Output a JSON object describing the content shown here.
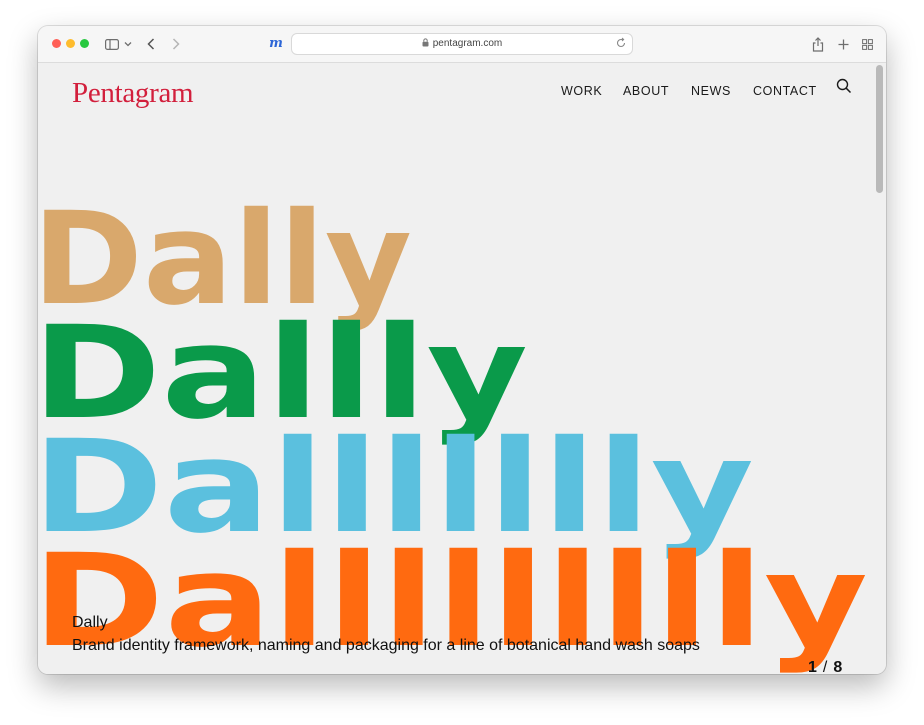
{
  "browser": {
    "url": "pentagram.com"
  },
  "site": {
    "logo": "Pentagram",
    "nav": [
      {
        "label": "WORK"
      },
      {
        "label": "ABOUT"
      },
      {
        "label": "NEWS"
      },
      {
        "label": "CONTACT"
      }
    ]
  },
  "hero": {
    "words": [
      {
        "text": "Dally",
        "color": "#d9a86c"
      },
      {
        "text": "Dallly",
        "color": "#0a9a4a"
      },
      {
        "text": "Dallllllly",
        "color": "#5bc0de"
      },
      {
        "text": "Dallllllllly",
        "color": "#ff6a10"
      }
    ]
  },
  "project": {
    "name": "Dally",
    "description": "Brand identity framework, naming and packaging for a line of botanical hand wash soaps"
  },
  "slideshow": {
    "current": "1",
    "separator": "/",
    "total": "8"
  },
  "colors": {
    "logo": "#d21f3c",
    "page_background": "#f0f0f0"
  }
}
